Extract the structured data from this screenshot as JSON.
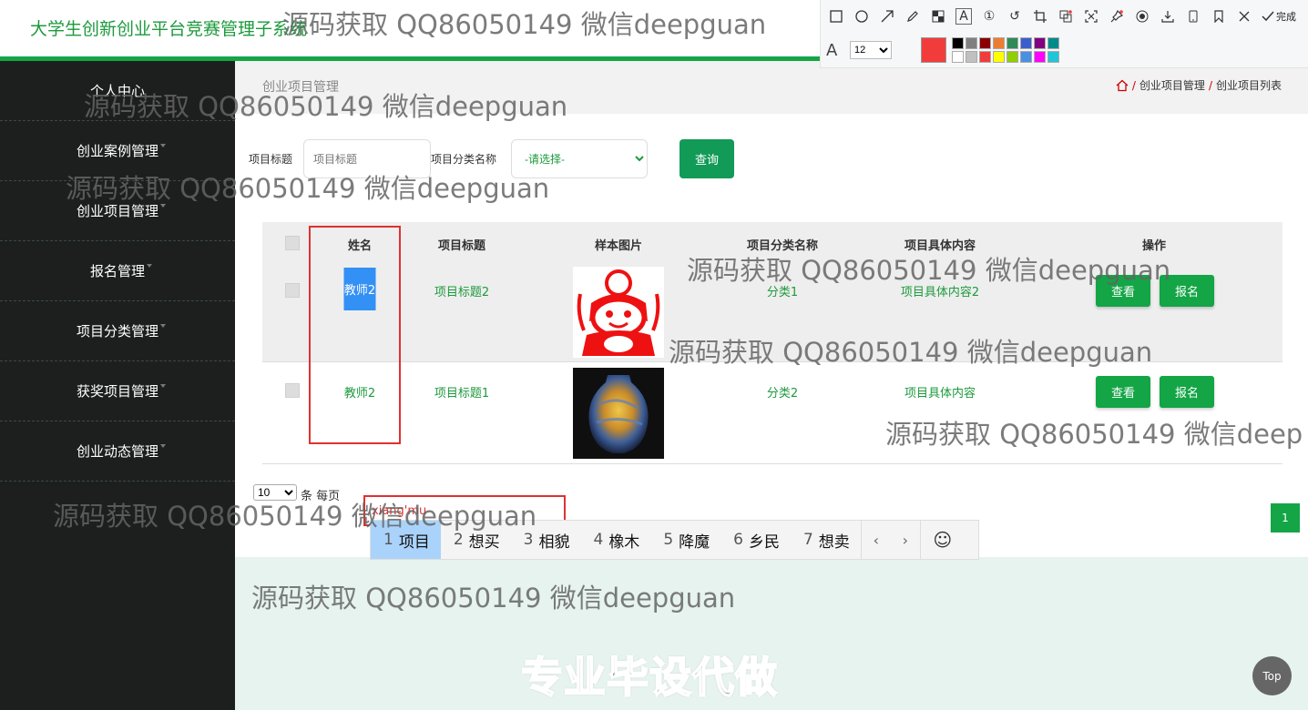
{
  "header": {
    "title": "大学生创新创业平台竞赛管理子系统"
  },
  "sidebar": {
    "items": [
      {
        "label": "个人中心"
      },
      {
        "label": "创业案例管理"
      },
      {
        "label": "创业项目管理"
      },
      {
        "label": "报名管理"
      },
      {
        "label": "项目分类管理"
      },
      {
        "label": "获奖项目管理"
      },
      {
        "label": "创业动态管理"
      }
    ]
  },
  "page": {
    "heading": "创业项目管理"
  },
  "breadcrumb": {
    "items": [
      "创业项目管理",
      "创业项目列表"
    ],
    "separator": "/"
  },
  "search": {
    "title_label": "项目标题",
    "title_placeholder": "项目标题",
    "category_label": "项目分类名称",
    "category_selected": "-请选择-",
    "query_button": "查询"
  },
  "table": {
    "columns": [
      "姓名",
      "项目标题",
      "样本图片",
      "项目分类名称",
      "项目具体内容",
      "操作"
    ],
    "rows": [
      {
        "name": "教师2",
        "title": "项目标题2",
        "image": "red-papercut-image",
        "category": "分类1",
        "content": "项目具体内容2",
        "view": "查看",
        "signup": "报名"
      },
      {
        "name": "教师2",
        "title": "项目标题1",
        "image": "glazed-vase-image",
        "category": "分类2",
        "content": "项目具体内容",
        "view": "查看",
        "signup": "报名"
      }
    ]
  },
  "pagination": {
    "page_size": "10",
    "page_size_label": "条 每页",
    "current_page": "1"
  },
  "annotation": {
    "text": "xiang'mu"
  },
  "ime": {
    "candidates": [
      {
        "n": "1",
        "text": "项目"
      },
      {
        "n": "2",
        "text": "想买"
      },
      {
        "n": "3",
        "text": "相貌"
      },
      {
        "n": "4",
        "text": "橡木"
      },
      {
        "n": "5",
        "text": "降魔"
      },
      {
        "n": "6",
        "text": "乡民"
      },
      {
        "n": "7",
        "text": "想卖"
      }
    ],
    "prev": "‹",
    "next": "›",
    "emoji": "☺"
  },
  "toolbar": {
    "done_label": "完成",
    "font_size": "12",
    "current_color": "#f23c3c",
    "palette": [
      "#000000",
      "#808080",
      "#8b0000",
      "#ed7d31",
      "#2e8b57",
      "#3a5fcd",
      "#800080",
      "#008b8b",
      "#ffffff",
      "#c0c0c0",
      "#f23c3c",
      "#ffff00",
      "#8fce00",
      "#4a90e2",
      "#ff00ff",
      "#20c5d8"
    ]
  },
  "watermarks": [
    "源码获取 QQ86050149 微信deepguan",
    "源码获取 QQ86050149 微信deepguan",
    "源码获取 QQ86050149 微信deepguan",
    "源码获取 QQ86050149 微信deepguan",
    "源码获取 QQ86050149 微信deepguan",
    "源码获取 QQ86050149 微信deep",
    "源码获取 QQ86050149 微信deepguan",
    "源码获取 QQ86050149 微信deepguan"
  ],
  "promo": "专业毕设代做",
  "top_button": "Top",
  "colors": {
    "accent": "#13a546",
    "sidebar_bg": "#1d1f1e",
    "link_green": "#1c9a3c",
    "selection_blue": "#3390f5",
    "annotation_red": "#e03131"
  }
}
